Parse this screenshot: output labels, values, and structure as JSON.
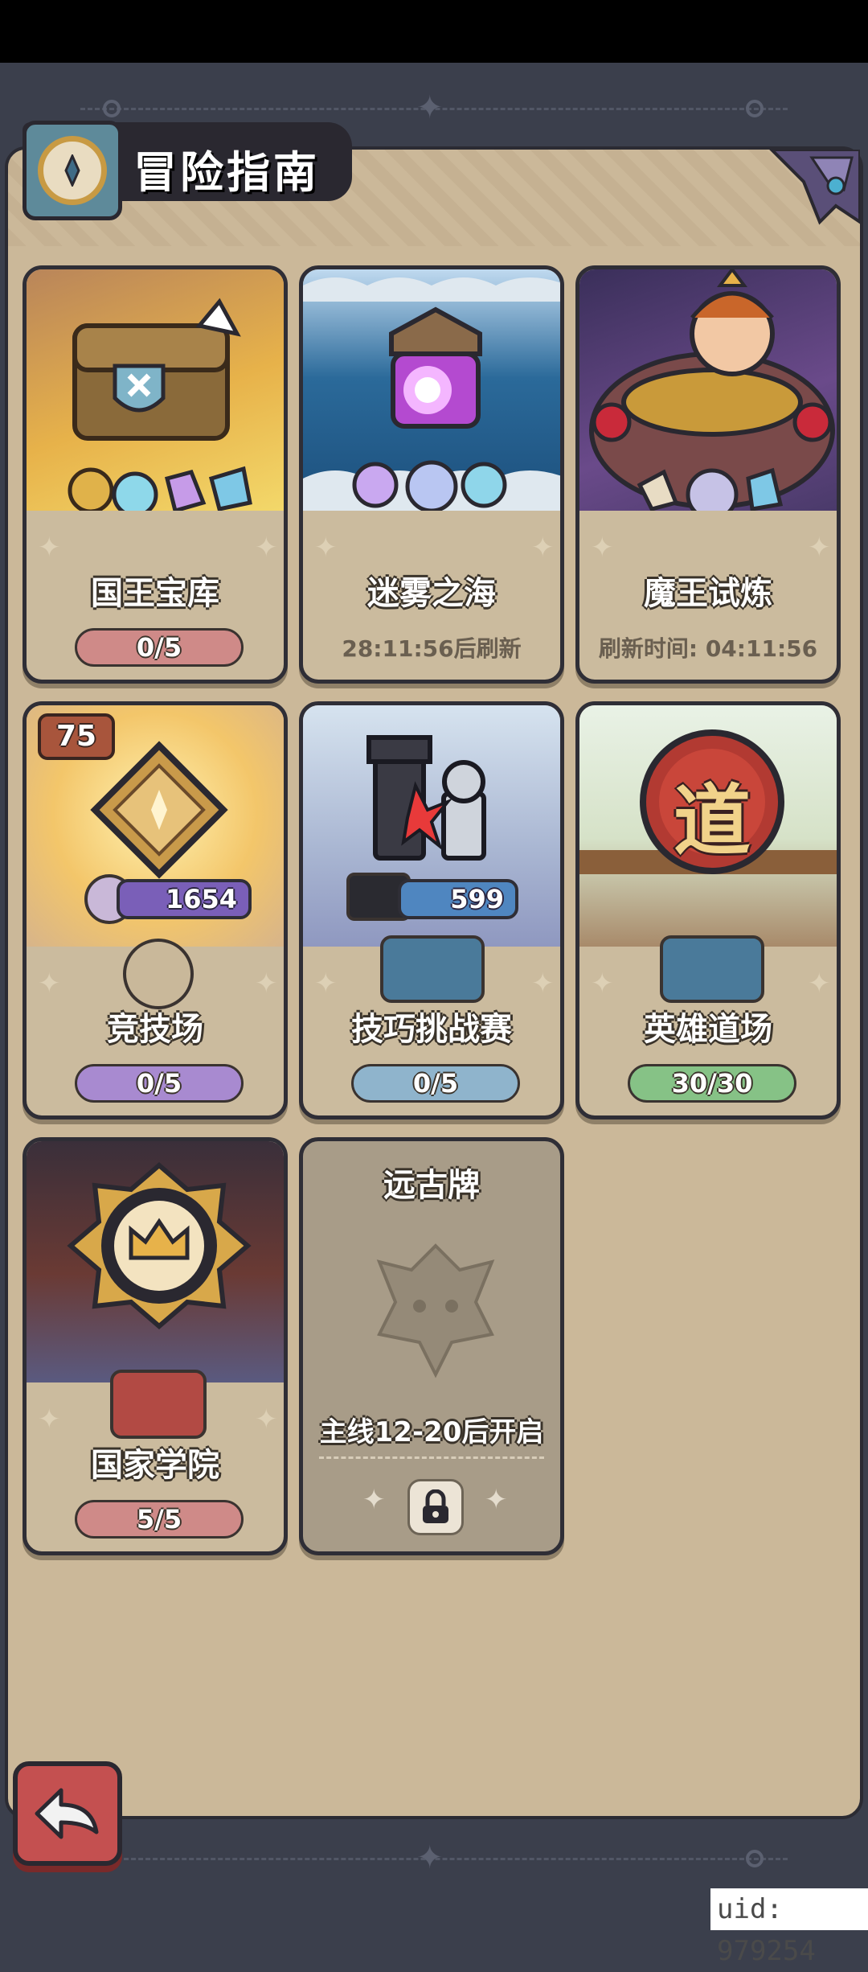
{
  "header": {
    "title": "冒险指南"
  },
  "cards": [
    {
      "name": "国王宝库",
      "status": "0/5",
      "status_color": "#cf8a88"
    },
    {
      "name": "迷雾之海",
      "status": "28:11:56后刷新"
    },
    {
      "name": "魔王试炼",
      "status": "刷新时间: 04:11:56"
    },
    {
      "name": "竞技场",
      "status": "0/5",
      "status_color": "#a88ad0",
      "level_badge": "75",
      "score": "1654"
    },
    {
      "name": "技巧挑战赛",
      "status": "0/5",
      "status_color": "#8fb4cc",
      "score": "599"
    },
    {
      "name": "英雄道场",
      "status": "30/30",
      "status_color": "#86c286",
      "emblem_char": "道"
    },
    {
      "name": "国家学院",
      "status": "5/5",
      "status_color": "#cf8a88"
    }
  ],
  "locked_card": {
    "name": "远古牌",
    "unlock_condition": "主线12-20后开启"
  },
  "uid_label": "uid: 979254"
}
